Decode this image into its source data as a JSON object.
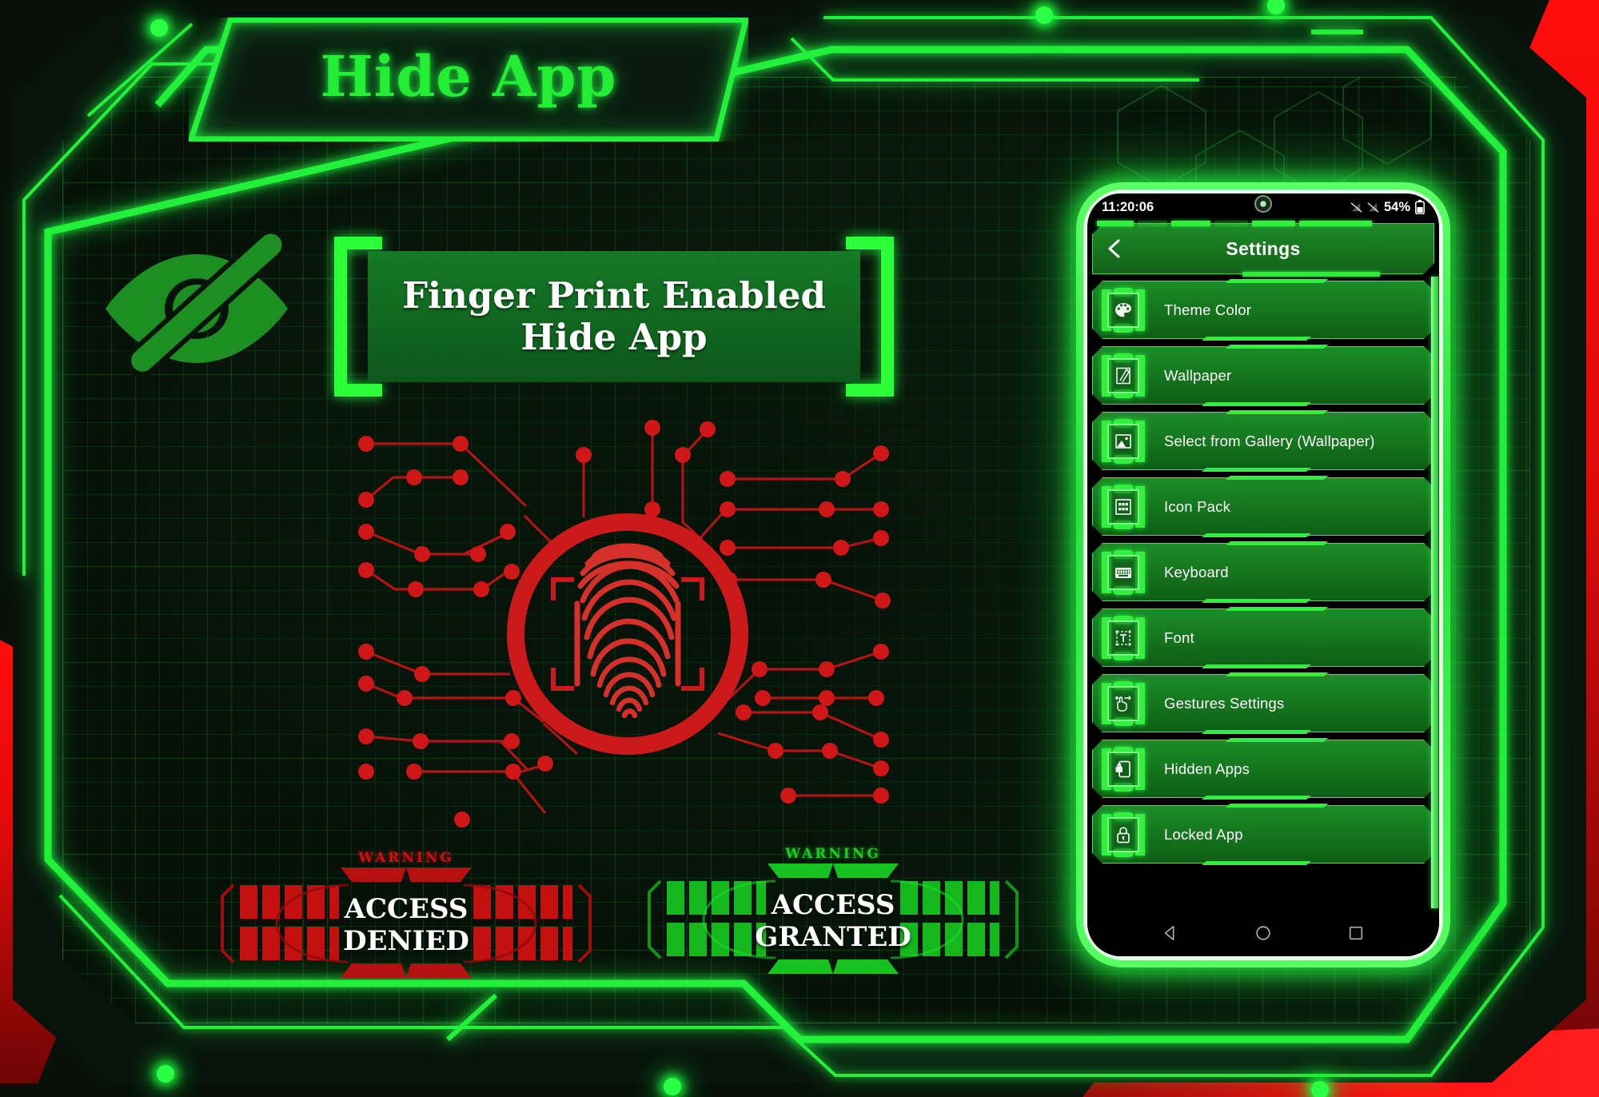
{
  "app": {
    "title": "Hide App",
    "accent_green": "#22ee33",
    "accent_red": "#e01010",
    "bg": "#071009"
  },
  "banner": {
    "line1": "Finger Print Enabled",
    "line2": "Hide App",
    "icon": "eye-slash-icon"
  },
  "scanner": {
    "icon": "fingerprint-icon",
    "color": "#cc1a1a"
  },
  "badges": [
    {
      "warning": "WARNING",
      "line1": "ACCESS",
      "line2": "DENIED",
      "color": "#cc1111",
      "state": "denied"
    },
    {
      "warning": "WARNING",
      "line1": "ACCESS",
      "line2": "GRANTED",
      "color": "#1dcc22",
      "state": "granted"
    }
  ],
  "phone": {
    "status": {
      "time": "11:20:06",
      "battery_percent": "54%",
      "signal_icons": [
        "signal-off-icon",
        "signal-off-icon"
      ],
      "battery_icon": "battery-icon",
      "camera_icon": "front-camera-icon"
    },
    "header": {
      "title": "Settings",
      "back_icon": "chevron-left-icon"
    },
    "settings_items": [
      {
        "label": "Theme Color",
        "icon": "palette-icon"
      },
      {
        "label": "Wallpaper",
        "icon": "wallpaper-icon"
      },
      {
        "label": "Select from Gallery (Wallpaper)",
        "icon": "image-icon"
      },
      {
        "label": "Icon Pack",
        "icon": "grid-icon"
      },
      {
        "label": "Keyboard",
        "icon": "keyboard-icon"
      },
      {
        "label": "Font",
        "icon": "text-box-icon"
      },
      {
        "label": "Gestures Settings",
        "icon": "swipe-hand-icon"
      },
      {
        "label": "Hidden Apps",
        "icon": "phone-lock-icon"
      },
      {
        "label": "Locked App",
        "icon": "padlock-icon"
      }
    ],
    "navigation": [
      {
        "name": "back",
        "icon": "triangle-back-icon"
      },
      {
        "name": "home",
        "icon": "circle-home-icon"
      },
      {
        "name": "recents",
        "icon": "square-recents-icon"
      }
    ]
  }
}
